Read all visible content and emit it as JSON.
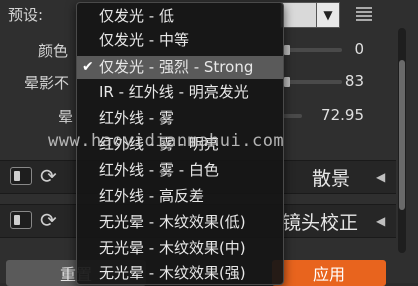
{
  "preset": {
    "label": "预设:",
    "dropdown_arrow": "triangle-down-icon",
    "menu_icon": "list-menu-icon"
  },
  "controls": [
    {
      "label": "颜色",
      "value": "0"
    },
    {
      "label": "晕影不",
      "value": "83"
    },
    {
      "label": "晕",
      "value": "72.95"
    }
  ],
  "sections": [
    {
      "title": "散景"
    },
    {
      "title": "镜头校正"
    }
  ],
  "buttons": {
    "reset": "重置",
    "apply": "应用"
  },
  "dropdown": {
    "selected_index": 2,
    "items": [
      "仅发光 - 低",
      "仅发光 - 中等",
      "仅发光 - 强烈 - Strong",
      "IR - 红外线 - 明亮发光",
      "红外线 - 雾",
      "红外线 - 雾 - 明亮",
      "红外线 - 雾 - 白色",
      "红外线 - 高反差",
      "无光晕 - 木纹效果(低)",
      "无光晕 - 木纹效果(中)",
      "无光晕 - 木纹效果(强)"
    ]
  },
  "watermark": "www.haoyidianmahui.com",
  "colors": {
    "apply_button": "#e8641e",
    "reset_button": "#5a5a5a",
    "selected_item": "#5a5a5a"
  }
}
